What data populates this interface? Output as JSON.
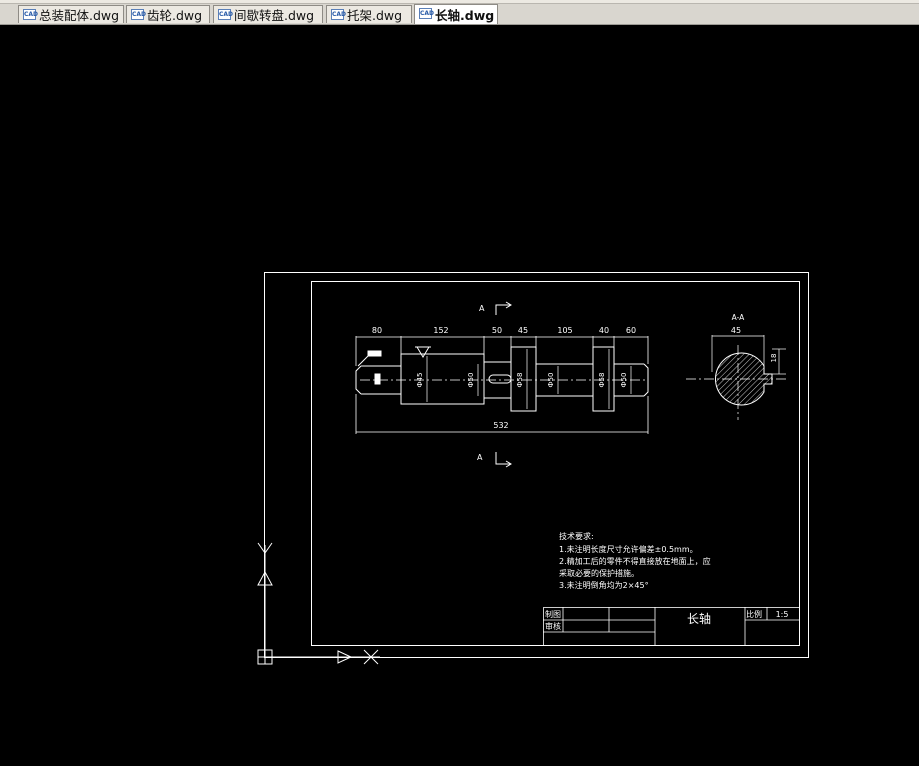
{
  "tabs": [
    {
      "label": "总装配体.dwg",
      "icon": "dwg-file-icon",
      "active": false
    },
    {
      "label": "齿轮.dwg",
      "icon": "dwg-file-icon",
      "active": false
    },
    {
      "label": "间歇转盘.dwg",
      "icon": "dwg-file-icon",
      "active": false
    },
    {
      "label": "托架.dwg",
      "icon": "dwg-file-icon",
      "active": false
    },
    {
      "label": "长轴.dwg",
      "icon": "dwg-file-icon",
      "active": true
    }
  ],
  "tab_icon_text": "CAD",
  "drawing": {
    "section_mark": "A",
    "section_title": "A-A",
    "dims_top": [
      "80",
      "152",
      "50",
      "45",
      "105",
      "40",
      "60"
    ],
    "dim_total": "532",
    "dim_section_width": "45",
    "dim_keyway": "18",
    "diameters": [
      "Ф45",
      "Ф50",
      "Ф58",
      "Ф50",
      "Ф58",
      "Ф50"
    ],
    "tech_title": "技术要求:",
    "tech_lines": [
      "1.未注明长度尺寸允许偏差±0.5mm。",
      "2.精加工后的零件不得直接放在地面上，应",
      "采取必要的保护措施。",
      "3.未注明倒角均为2×45°"
    ],
    "title_block": {
      "drawn_label": "制图",
      "checked_label": "审核",
      "part_name": "长轴",
      "scale_label": "比例",
      "scale_value": "1:5"
    }
  },
  "colors": {
    "background": "#000000",
    "lines": "#ffffff",
    "tab_active": "#ffffff",
    "tab_inactive": "#ece9e2"
  }
}
